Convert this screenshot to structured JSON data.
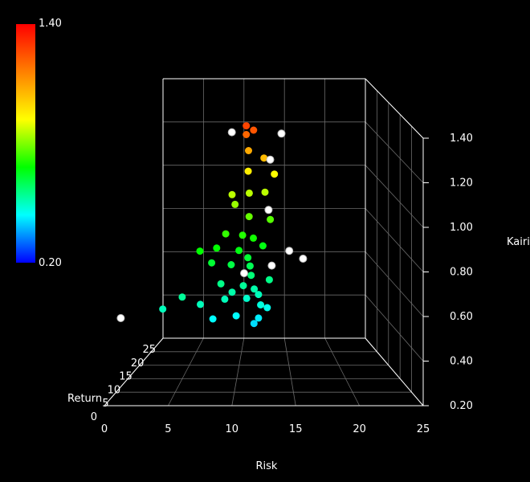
{
  "chart_data": {
    "type": "scatter",
    "title": "",
    "axes": {
      "x": {
        "label": "Risk",
        "range": [
          0,
          25
        ],
        "ticks": [
          "0",
          "5",
          "10",
          "15",
          "20",
          "25"
        ]
      },
      "y": {
        "label": "Return",
        "range": [
          0,
          25
        ],
        "ticks": [
          "0",
          "5",
          "10",
          "15",
          "20",
          "25"
        ]
      },
      "z": {
        "label": "Kairi",
        "range": [
          0.2,
          1.4
        ],
        "ticks": [
          "0.20",
          "0.40",
          "0.60",
          "0.80",
          "1.00",
          "1.20",
          "1.40"
        ]
      }
    },
    "colorbar": {
      "min_label": "0.20",
      "max_label": "1.40",
      "colors": [
        "#ff0000",
        "#ff8000",
        "#ffff00",
        "#00ff00",
        "#00ffff",
        "#0000ff"
      ]
    },
    "cloud_points": [
      [
        10.8,
        12.6,
        1.28
      ],
      [
        11.0,
        13.2,
        1.2
      ],
      [
        11.0,
        12.0,
        1.12
      ],
      [
        11.1,
        12.0,
        1.02
      ],
      [
        11.1,
        11.4,
        0.92
      ],
      [
        10.5,
        11.0,
        0.84
      ],
      [
        11.5,
        11.6,
        0.82
      ],
      [
        11.0,
        10.8,
        0.74
      ],
      [
        11.3,
        10.8,
        0.66
      ],
      [
        10.6,
        10.2,
        0.62
      ],
      [
        9.5,
        9.8,
        0.72
      ],
      [
        12.4,
        12.0,
        0.78
      ],
      [
        8.6,
        9.2,
        0.64
      ],
      [
        12.0,
        10.2,
        0.58
      ],
      [
        9.0,
        8.4,
        0.58
      ],
      [
        12.2,
        9.6,
        0.54
      ],
      [
        12.0,
        9.6,
        0.48
      ],
      [
        11.6,
        9.2,
        0.46
      ],
      [
        10.0,
        8.8,
        0.5
      ],
      [
        13.0,
        10.8,
        0.64
      ],
      [
        13.1,
        12.0,
        0.9
      ],
      [
        9.5,
        11.4,
        1.02
      ],
      [
        7.0,
        6.4,
        0.58
      ],
      [
        5.5,
        5.8,
        0.62
      ],
      [
        4.0,
        4.6,
        0.58
      ],
      [
        8.0,
        7.6,
        0.5
      ],
      [
        13.5,
        12.6,
        1.1
      ],
      [
        12.5,
        12.0,
        1.18
      ],
      [
        9.8,
        11.0,
        0.98
      ],
      [
        11.5,
        12.6,
        1.3
      ],
      [
        9.0,
        9.8,
        0.86
      ],
      [
        10.8,
        12.6,
        1.32
      ],
      [
        12.6,
        12.4,
        1.02
      ],
      [
        8.2,
        9.4,
        0.8
      ],
      [
        10.2,
        10.2,
        0.78
      ],
      [
        11.2,
        11.0,
        0.7
      ],
      [
        10.9,
        10.4,
        0.56
      ],
      [
        11.6,
        10.6,
        0.6
      ],
      [
        9.6,
        9.4,
        0.6
      ],
      [
        6.8,
        8.2,
        0.8
      ],
      [
        7.8,
        8.8,
        0.74
      ],
      [
        12.8,
        10.2,
        0.52
      ]
    ],
    "highlight_points": [
      [
        9.0,
        19.0,
        1.22
      ],
      [
        13.2,
        22.0,
        1.06
      ],
      [
        13.0,
        21.0,
        0.84
      ],
      [
        10.5,
        15.0,
        0.62
      ],
      [
        0.8,
        2.8,
        0.56
      ],
      [
        15.4,
        22.0,
        0.64
      ],
      [
        14.5,
        22.0,
        1.18
      ],
      [
        13.4,
        23.0,
        0.56
      ],
      [
        17.2,
        24.0,
        0.58
      ]
    ]
  }
}
